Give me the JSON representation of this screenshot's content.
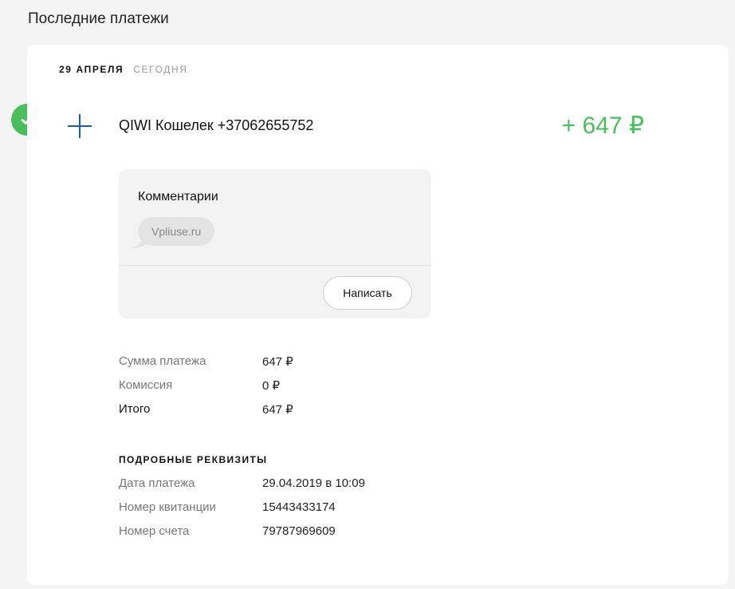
{
  "page": {
    "title": "Последние платежи"
  },
  "date_header": {
    "date": "29 АПРЕЛЯ",
    "relative": "СЕГОДНЯ"
  },
  "payment": {
    "recipient": "QIWI Кошелек +37062655752",
    "amount": "+ 647 ₽",
    "status": "success",
    "status_icon": "check-icon",
    "type_icon": "plus-icon"
  },
  "comments": {
    "title": "Комментарии",
    "items": [
      "Vpliuse.ru"
    ],
    "write_label": "Написать"
  },
  "summary": [
    {
      "label": "Сумма платежа",
      "value": "647 ₽"
    },
    {
      "label": "Комиссия",
      "value": "0 ₽"
    },
    {
      "label": "Итого",
      "value": "647 ₽"
    }
  ],
  "details": {
    "title": "ПОДРОБНЫЕ РЕКВИЗИТЫ",
    "rows": [
      {
        "label": "Дата платежа",
        "value": "29.04.2019 в 10:09"
      },
      {
        "label": "Номер квитанции",
        "value": "15443433174"
      },
      {
        "label": "Номер счета",
        "value": "79787969609"
      }
    ]
  },
  "colors": {
    "accent_green": "#4bbd5c",
    "icon_blue": "#1a5fa8",
    "card_bg": "#ffffff",
    "page_bg": "#f4f4f4"
  }
}
